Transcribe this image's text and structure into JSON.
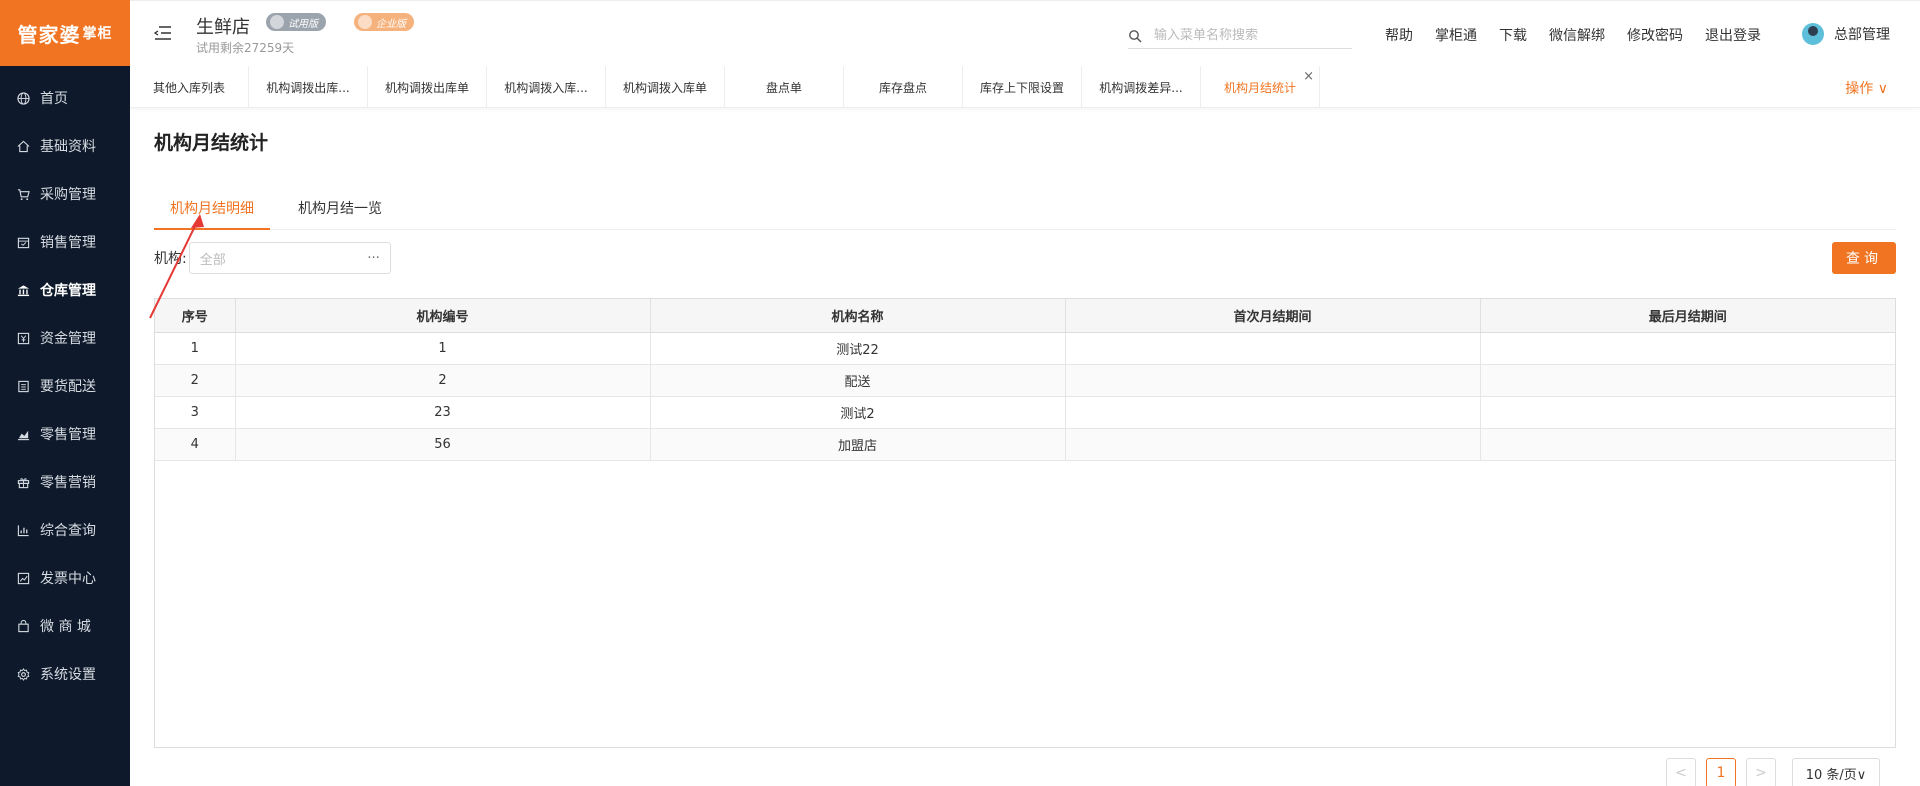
{
  "app": {
    "logo_main": "管家婆",
    "logo_sub": "掌柜",
    "store_name": "生鲜店",
    "trial_badge": "试用版",
    "edition_badge": "企业版",
    "trial_remaining": "试用剩余27259天"
  },
  "search": {
    "placeholder": "输入菜单名称搜索"
  },
  "top_links": {
    "help": "帮助",
    "zhanggui": "掌柜通",
    "download": "下载",
    "wechat_unbind": "微信解绑",
    "change_password": "修改密码",
    "logout": "退出登录"
  },
  "user": {
    "name": "总部管理"
  },
  "sidebar": {
    "items": [
      {
        "label": "首页",
        "icon": "globe-icon"
      },
      {
        "label": "基础资料",
        "icon": "home-icon"
      },
      {
        "label": "采购管理",
        "icon": "cart-icon"
      },
      {
        "label": "销售管理",
        "icon": "calendar-icon"
      },
      {
        "label": "仓库管理",
        "icon": "bank-icon"
      },
      {
        "label": "资金管理",
        "icon": "money-icon"
      },
      {
        "label": "要货配送",
        "icon": "doc-icon"
      },
      {
        "label": "零售管理",
        "icon": "bar-icon"
      },
      {
        "label": "零售营销",
        "icon": "gift-icon"
      },
      {
        "label": "综合查询",
        "icon": "chart-icon"
      },
      {
        "label": "发票中心",
        "icon": "trend-icon"
      },
      {
        "label": "微 商 城",
        "icon": "bag-icon"
      },
      {
        "label": "系统设置",
        "icon": "gear-icon"
      }
    ]
  },
  "tabs": [
    {
      "label": "其他入库列表"
    },
    {
      "label": "机构调拨出库..."
    },
    {
      "label": "机构调拨出库单"
    },
    {
      "label": "机构调拨入库..."
    },
    {
      "label": "机构调拨入库单"
    },
    {
      "label": "盘点单"
    },
    {
      "label": "库存盘点"
    },
    {
      "label": "库存上下限设置"
    },
    {
      "label": "机构调拨差异..."
    },
    {
      "label": "机构月结统计"
    }
  ],
  "tab_close": "×",
  "operations": "操作 ∨",
  "page": {
    "title": "机构月结统计",
    "subtabs": {
      "detail": "机构月结明细",
      "overview": "机构月结一览"
    },
    "filter_label": "机构:",
    "filter_value": "全部",
    "filter_more": "···",
    "query_button": "查询"
  },
  "table": {
    "headers": {
      "seq": "序号",
      "code": "机构编号",
      "name": "机构名称",
      "first": "首次月结期间",
      "last": "最后月结期间"
    },
    "rows": [
      {
        "seq": "1",
        "code": "1",
        "name": "测试22",
        "first": "",
        "last": ""
      },
      {
        "seq": "2",
        "code": "2",
        "name": "配送",
        "first": "",
        "last": ""
      },
      {
        "seq": "3",
        "code": "23",
        "name": "测试2",
        "first": "",
        "last": ""
      },
      {
        "seq": "4",
        "code": "56",
        "name": "加盟店",
        "first": "",
        "last": ""
      }
    ]
  },
  "pager": {
    "prev": "<",
    "current": "1",
    "next": ">",
    "page_size": "10 条/页∨"
  },
  "colors": {
    "accent": "#f07421",
    "sidebar_bg": "#0e1a2b",
    "annotation_arrow": "#e53935"
  }
}
